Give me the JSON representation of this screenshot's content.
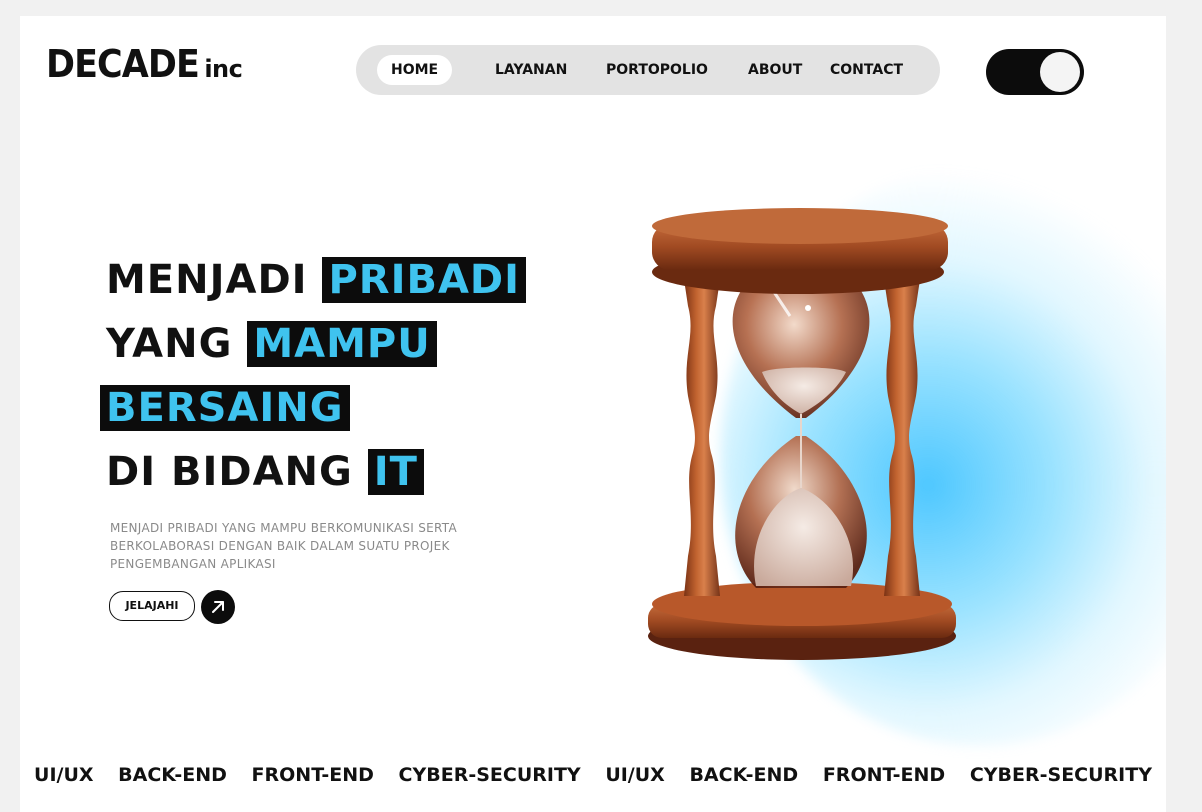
{
  "brand": {
    "name": "DECADE",
    "suffix": "inc"
  },
  "nav": {
    "items": [
      {
        "label": "HOME",
        "active": true
      },
      {
        "label": "LAYANAN",
        "active": false
      },
      {
        "label": "PORTOPOLIO",
        "active": false
      },
      {
        "label": "ABOUT",
        "active": false
      },
      {
        "label": "CONTACT",
        "active": false
      }
    ]
  },
  "theme_toggle": {
    "state": "on"
  },
  "hero": {
    "line1": {
      "plain": "MENJADI",
      "highlight": "PRIBADI"
    },
    "line2": {
      "plain": "YANG",
      "highlight": "MAMPU"
    },
    "line3": {
      "highlight": "BERSAING"
    },
    "line4": {
      "plain": "DI BIDANG",
      "highlight": "IT"
    },
    "description": "MENJADI PRIBADI YANG MAMPU BERKOMUNIKASI SERTA BERKOLABORASI DENGAN BAIK DALAM SUATU PROJEK PENGEMBANGAN APLIKASI",
    "cta_label": "JELAJAHI",
    "cta_icon": "arrow-up-right-icon",
    "image": "hourglass"
  },
  "services": [
    "UI/UX",
    "BACK-END",
    "FRONT-END",
    "CYBER-SECURITY",
    "UI/UX",
    "BACK-END",
    "FRONT-END",
    "CYBER-SECURITY"
  ],
  "colors": {
    "accent": "#3fc3ef",
    "dark": "#0c0c0c",
    "nav_bg": "#e3e3e3",
    "glow": "#44c4ff",
    "wood": "#a04a22"
  }
}
